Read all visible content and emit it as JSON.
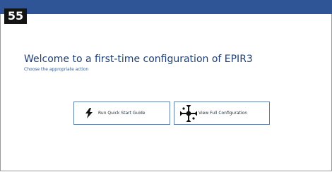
{
  "page_badge": "55",
  "welcome": {
    "title": "Welcome to a first-time configuration of EPIR3",
    "subtitle": "Choose the appropriate action"
  },
  "actions": [
    {
      "label": "Run Quick Start Guide",
      "icon": "lightning-bolt-icon"
    },
    {
      "label": "View Full Configuration",
      "icon": "configuration-network-icon"
    }
  ],
  "colors": {
    "title_bar": "#2f5597",
    "title_text": "#1f3f72",
    "button_border": "#5f7fa6"
  }
}
